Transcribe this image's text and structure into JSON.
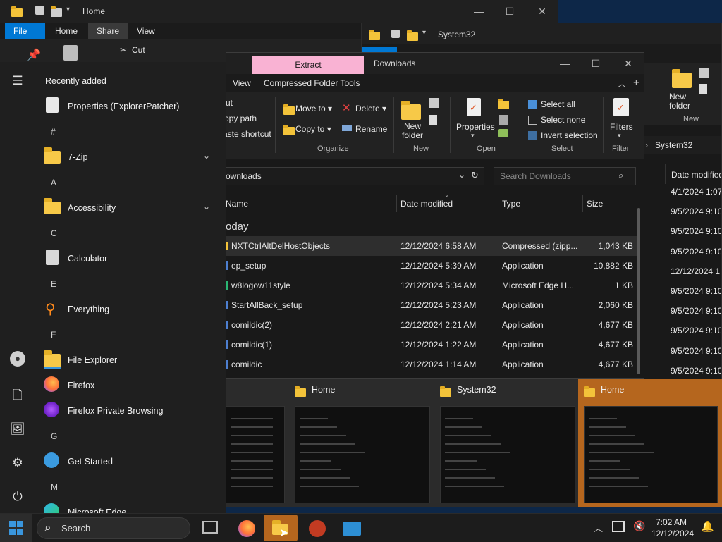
{
  "back_window": {
    "title": "Home",
    "tabs": [
      "File",
      "Home",
      "Share",
      "View"
    ],
    "cut_label": "Cut"
  },
  "system32_window": {
    "title": "System32",
    "breadcrumb": "System32",
    "column_header": "Date modified",
    "dates": [
      "4/1/2024 1:07",
      "9/5/2024 9:10",
      "9/5/2024 9:10",
      "9/5/2024 9:10",
      "12/12/2024 1:1",
      "9/5/2024 9:10",
      "9/5/2024 9:10",
      "9/5/2024 9:10",
      "9/5/2024 9:10",
      "9/5/2024 9:10"
    ],
    "new_folder_label": "New folder",
    "new_group": "New"
  },
  "downloads": {
    "title": "Downloads",
    "extract_tab": "Extract",
    "tabs": [
      "View",
      "Compressed Folder Tools"
    ],
    "clipboard": {
      "cut": "ut",
      "copy_path": "opy path",
      "paste_shortcut": "aste shortcut"
    },
    "organize": {
      "move_to": "Move to",
      "copy_to": "Copy to",
      "delete": "Delete",
      "rename": "Rename",
      "label": "Organize"
    },
    "new": {
      "new_folder": "New folder",
      "label": "New"
    },
    "open": {
      "properties": "Properties",
      "label": "Open"
    },
    "select": {
      "select_all": "Select all",
      "select_none": "Select none",
      "invert": "Invert selection",
      "label": "Select"
    },
    "filters": {
      "filters": "Filters",
      "label": "Filter"
    },
    "address": "ownloads",
    "search_placeholder": "Search Downloads",
    "columns": {
      "name": "Name",
      "date": "Date modified",
      "type": "Type",
      "size": "Size"
    },
    "group": "oday",
    "files": [
      {
        "name": "NXTCtrlAltDelHostObjects",
        "date": "12/12/2024 6:58 AM",
        "type": "Compressed (zipp...",
        "size": "1,043 KB"
      },
      {
        "name": "ep_setup",
        "date": "12/12/2024 5:39 AM",
        "type": "Application",
        "size": "10,882 KB"
      },
      {
        "name": "w8logow11style",
        "date": "12/12/2024 5:34 AM",
        "type": "Microsoft Edge H...",
        "size": "1 KB"
      },
      {
        "name": "StartAllBack_setup",
        "date": "12/12/2024 5:23 AM",
        "type": "Application",
        "size": "2,060 KB"
      },
      {
        "name": "comildic(2)",
        "date": "12/12/2024 2:21 AM",
        "type": "Application",
        "size": "4,677 KB"
      },
      {
        "name": "comildic(1)",
        "date": "12/12/2024 1:22 AM",
        "type": "Application",
        "size": "4,677 KB"
      },
      {
        "name": "comildic",
        "date": "12/12/2024 1:14 AM",
        "type": "Application",
        "size": "4,677 KB"
      }
    ]
  },
  "start_menu": {
    "heading": "Recently added",
    "items": [
      {
        "kind": "app",
        "label": "Properties (ExplorerPatcher)",
        "icon": "properties-icon"
      },
      {
        "kind": "letter",
        "label": "#"
      },
      {
        "kind": "folder",
        "label": "7-Zip",
        "icon": "folder-icon"
      },
      {
        "kind": "letter",
        "label": "A"
      },
      {
        "kind": "folder",
        "label": "Accessibility",
        "icon": "folder-icon"
      },
      {
        "kind": "letter",
        "label": "C"
      },
      {
        "kind": "app",
        "label": "Calculator",
        "icon": "calculator-icon"
      },
      {
        "kind": "letter",
        "label": "E"
      },
      {
        "kind": "app",
        "label": "Everything",
        "icon": "magnifier-icon"
      },
      {
        "kind": "letter",
        "label": "F"
      },
      {
        "kind": "app",
        "label": "File Explorer",
        "icon": "file-explorer-icon"
      },
      {
        "kind": "app",
        "label": "Firefox",
        "icon": "firefox-icon"
      },
      {
        "kind": "app",
        "label": "Firefox Private Browsing",
        "icon": "firefox-private-icon"
      },
      {
        "kind": "letter",
        "label": "G"
      },
      {
        "kind": "app",
        "label": "Get Started",
        "icon": "get-started-icon"
      },
      {
        "kind": "letter",
        "label": "M"
      },
      {
        "kind": "app",
        "label": "Microsoft Edge",
        "icon": "edge-icon"
      }
    ]
  },
  "thumbnails": [
    {
      "title": "",
      "active": false
    },
    {
      "title": "Home",
      "active": false
    },
    {
      "title": "System32",
      "active": false
    },
    {
      "title": "Home",
      "active": true
    }
  ],
  "taskbar": {
    "search_label": "Search",
    "time": "7:02 AM",
    "date": "12/12/2024"
  },
  "colors": {
    "accent": "#0078d4",
    "extract_tab": "#f9b2d3",
    "active_thumb": "#b5661e",
    "folder": "#f3c33a"
  }
}
